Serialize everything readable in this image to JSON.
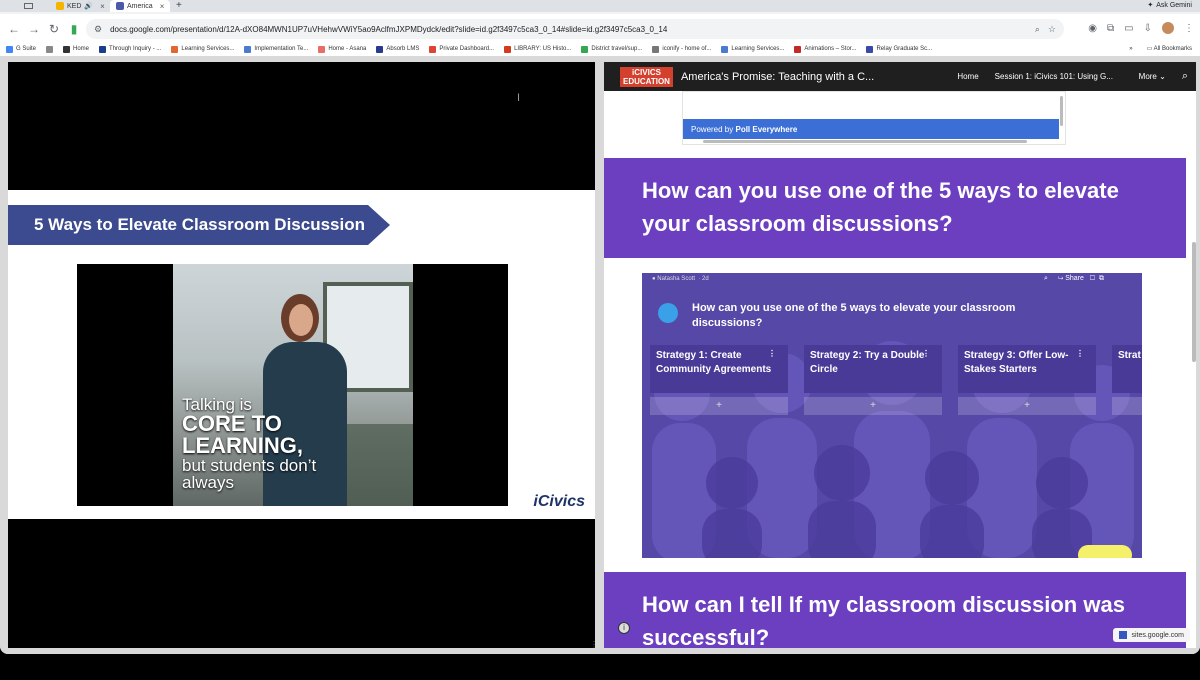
{
  "browser": {
    "tabs": [
      {
        "label": "KED",
        "color": "#f4b400"
      },
      {
        "label": "America",
        "color": "#4a5aa8"
      }
    ],
    "new_tab": "+",
    "ask_gemini": "Ask Gemini",
    "url": "docs.google.com/presentation/d/12A-dXO84MWN1UP7uVHehwVWiY5ao9AclfmJXPMDydck/edit?slide=id.g2f3497c5ca3_0_14#slide=id.g2f3497c5ca3_0_14",
    "bookmarks": [
      {
        "label": "G Suite",
        "color": "#4285f4"
      },
      {
        "label": "",
        "color": "#888888"
      },
      {
        "label": "Home",
        "color": "#333333"
      },
      {
        "label": "Through Inquiry - ...",
        "color": "#1a3e8c"
      },
      {
        "label": "Learning Services...",
        "color": "#e2672f"
      },
      {
        "label": "Implementation Te...",
        "color": "#4a7bd0"
      },
      {
        "label": "Home - Asana",
        "color": "#e96c66"
      },
      {
        "label": "Absorb LMS",
        "color": "#2a3990"
      },
      {
        "label": "Private Dashboard...",
        "color": "#d43"
      },
      {
        "label": "LIBRARY: US Histo...",
        "color": "#d43b1e"
      },
      {
        "label": "District travel/sup...",
        "color": "#33a852"
      },
      {
        "label": "iconify - home of...",
        "color": "#777777"
      },
      {
        "label": "Learning Services...",
        "color": "#4a7bd0"
      },
      {
        "label": "Animations – Stor...",
        "color": "#c62828"
      },
      {
        "label": "Relay Graduate Sc...",
        "color": "#3949ab"
      }
    ],
    "bookmarks_more": "»",
    "all_bookmarks": "All Bookmarks"
  },
  "slide": {
    "banner_title": "5 Ways to Elevate Classroom Discussion",
    "caption_line1": "Talking is",
    "caption_line2a": "CORE TO",
    "caption_line2b": "LEARNING,",
    "caption_line3a": "but students don’t",
    "caption_line3b": "always",
    "logo": "iCivics"
  },
  "site": {
    "logo_line1": "iCIVICS",
    "logo_line2": "EDUCATION",
    "title": "America's Promise: Teaching with a C...",
    "nav": [
      "Home",
      "Session 1: iCivics 101: Using G...",
      "More"
    ],
    "poll_powered": "Powered by",
    "poll_brand": "Poll Everywhere",
    "section1_heading": "How can you use one of the 5 ways to elevate your classroom discussions?",
    "padlet": {
      "author": "Natasha Scott",
      "time": "2d",
      "share": "Share",
      "title": "How can you use one of the 5 ways to elevate your classroom discussions?",
      "columns": [
        "Strategy 1: Create Community Agreements",
        "Strategy 2: Try a Double Circle",
        "Strategy 3: Offer Low-Stakes Starters",
        "Strat Hand"
      ],
      "add": "+"
    },
    "section2_heading": "How can I tell If my classroom discussion was successful?",
    "sites_badge": "sites.google.com"
  }
}
